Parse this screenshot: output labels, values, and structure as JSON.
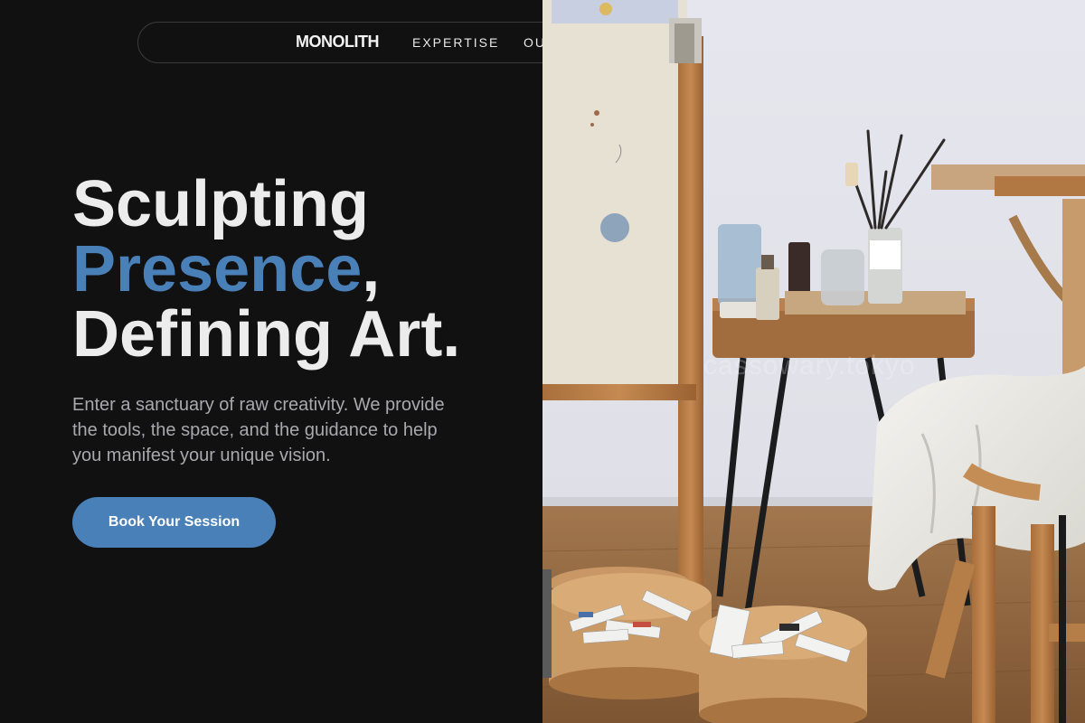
{
  "nav": {
    "brand": "MONOLITH",
    "links": [
      "EXPERTISE",
      "OU"
    ]
  },
  "hero": {
    "line1": "Sculpting",
    "line2_accent": "Presence",
    "line2_suffix": ",",
    "line3": "Defining Art.",
    "description": "Enter a sanctuary of raw creativity. We provide the tools, the space, and the guidance to help you manifest your unique vision.",
    "cta_label": "Book Your Session"
  },
  "photo": {
    "watermark": "cassowary.tokyo",
    "subject": "art-studio-easel-table-paint-tubes"
  },
  "colors": {
    "background": "#111112",
    "accent": "#4a80b8",
    "heading": "#ececec",
    "body_text": "#a9a9ad",
    "nav_border": "#3a3a3c"
  }
}
